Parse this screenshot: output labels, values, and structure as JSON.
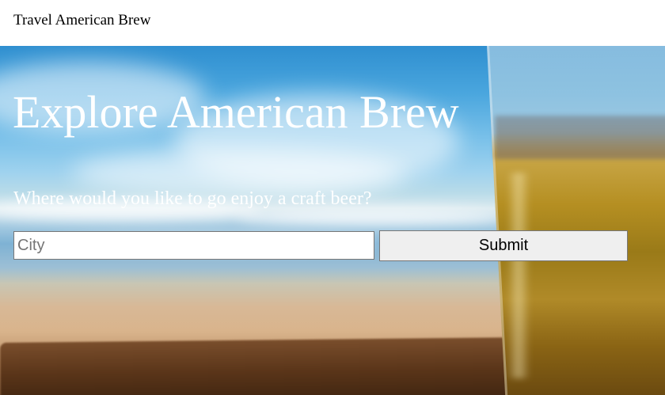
{
  "header": {
    "brand": "Travel American Brew"
  },
  "hero": {
    "title": "Explore American Brew",
    "subtitle": "Where would you like to go enjoy a craft beer?"
  },
  "search": {
    "placeholder": "City",
    "value": "",
    "submit_label": "Submit"
  }
}
